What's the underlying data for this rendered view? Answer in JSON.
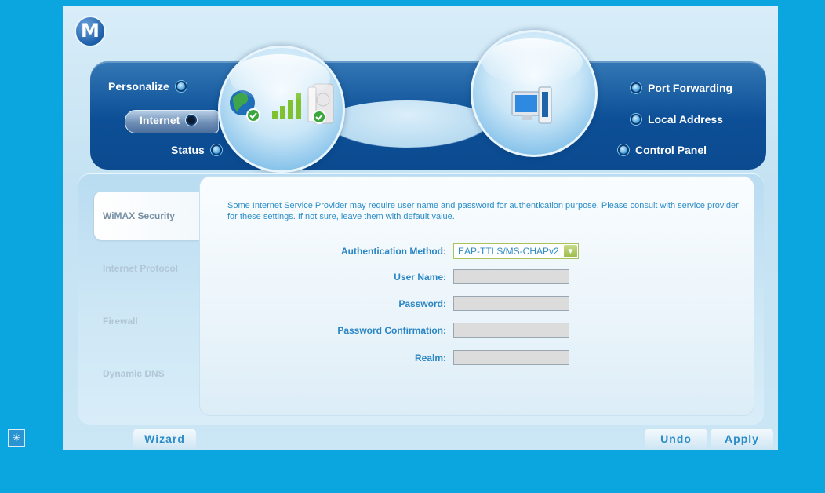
{
  "brand": {
    "logo_glyph": "M"
  },
  "nav": {
    "left": [
      {
        "label": "Personalize",
        "active": false
      },
      {
        "label": "Internet",
        "active": true
      },
      {
        "label": "Status",
        "active": false
      }
    ],
    "right": [
      {
        "label": "Port Forwarding"
      },
      {
        "label": "Local Address"
      },
      {
        "label": "Control Panel"
      }
    ]
  },
  "sidetabs": [
    {
      "label": "WiMAX Security",
      "active": true
    },
    {
      "label": "Internet Protocol",
      "active": false
    },
    {
      "label": "Firewall",
      "active": false
    },
    {
      "label": "Dynamic DNS",
      "active": false
    }
  ],
  "panel": {
    "description": "Some Internet Service Provider may require user name and password for authentication purpose. Please consult with service provider for these settings. If not sure, leave them with default value.",
    "auth_method_label": "Authentication Method:",
    "auth_method_value": "EAP-TTLS/MS-CHAPv2",
    "username_label": "User Name:",
    "username_value": "",
    "password_label": "Password:",
    "password_value": "",
    "password_confirm_label": "Password Confirmation:",
    "password_confirm_value": "",
    "realm_label": "Realm:",
    "realm_value": ""
  },
  "footer": {
    "wizard_label": "Wizard",
    "undo_label": "Undo",
    "apply_label": "Apply"
  },
  "colors": {
    "page_bg": "#0ba6df",
    "nav_band": "#0d4f96",
    "accent_text": "#2b8cc7"
  }
}
